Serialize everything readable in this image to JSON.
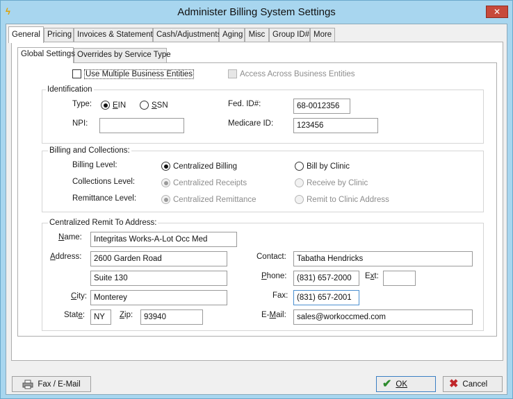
{
  "window": {
    "title": "Administer Billing System Settings",
    "close_glyph": "✕"
  },
  "tabs": [
    {
      "label": "General",
      "active": true
    },
    {
      "label": "Pricing"
    },
    {
      "label": "Invoices & Statements"
    },
    {
      "label": "Cash/Adjustments"
    },
    {
      "label": "Aging"
    },
    {
      "label": "Misc"
    },
    {
      "label": "Group ID#"
    },
    {
      "label": "More"
    }
  ],
  "subtabs": [
    {
      "label": "Global Settings",
      "active": true
    },
    {
      "label": "Overrides by Service Type"
    }
  ],
  "options": {
    "use_multiple_label": "Use Multiple Business Entities",
    "use_multiple_checked": false,
    "access_across_label": "Access Across Business Entities",
    "access_across_checked": false,
    "access_across_enabled": false
  },
  "identification": {
    "title": "Identification",
    "type_label": "Type:",
    "ein_label": "EIN",
    "ssn_label": "SSN",
    "selected_type": "EIN",
    "fed_id_label": "Fed. ID#:",
    "fed_id_value": "68-0012356",
    "npi_label": "NPI:",
    "npi_value": "",
    "medicare_label": "Medicare ID:",
    "medicare_value": "123456"
  },
  "billing": {
    "title": "Billing and Collections:",
    "billing_level_label": "Billing Level:",
    "centralized_billing": "Centralized Billing",
    "bill_by_clinic": "Bill by Clinic",
    "collections_level_label": "Collections Level:",
    "centralized_receipts": "Centralized Receipts",
    "receive_by_clinic": "Receive by Clinic",
    "remittance_level_label": "Remittance Level:",
    "centralized_remittance": "Centralized Remittance",
    "remit_to_clinic": "Remit to Clinic Address"
  },
  "remit": {
    "title": "Centralized Remit To Address:",
    "name_label": "Name:",
    "name_value": "Integritas Works-A-Lot Occ Med",
    "address_label": "Address:",
    "address1_value": "2600 Garden Road",
    "address2_value": "Suite 130",
    "city_label": "City:",
    "city_value": "Monterey",
    "state_label": "State:",
    "state_value": "NY",
    "zip_label": "Zip:",
    "zip_value": "93940",
    "contact_label": "Contact:",
    "contact_value": "Tabatha Hendricks",
    "phone_label": "Phone:",
    "phone_value": "(831) 657-2000",
    "ext_label": "Ext:",
    "ext_value": "",
    "fax_label": "Fax:",
    "fax_value": "(831) 657-2001",
    "email_label": "E-Mail:",
    "email_value": "sales@workoccmed.com"
  },
  "buttons": {
    "fax_email": "Fax / E-Mail",
    "ok": "OK",
    "cancel": "Cancel"
  },
  "colors": {
    "window_frame": "#a8d6ef",
    "close_button": "#c74a3b",
    "ok_check": "#2e8b2e",
    "cancel_x": "#c0262a"
  }
}
